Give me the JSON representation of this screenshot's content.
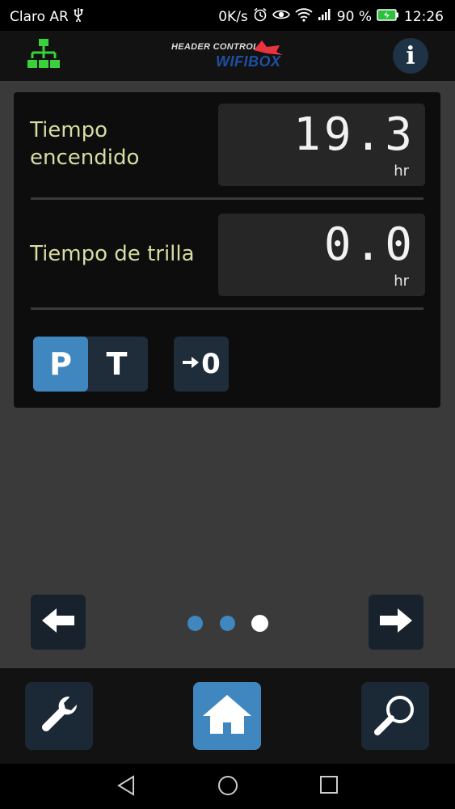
{
  "status_bar": {
    "carrier": "Claro AR",
    "speed": "0K/s",
    "battery_percent": "90 %",
    "time": "12:26",
    "icons": [
      "usb-icon",
      "alarm-icon",
      "eye-icon",
      "wifi-icon",
      "signal-icon",
      "battery-charging-icon"
    ]
  },
  "header": {
    "logo_top": "HEADER CONTROL",
    "logo_main": "WIFIBOX",
    "info_label": "i",
    "icons": [
      "network-tree-icon",
      "info-icon"
    ]
  },
  "panel": {
    "rows": [
      {
        "label_line1": "Tiempo",
        "label_line2": "encendido",
        "value": "19.3",
        "unit": "hr"
      },
      {
        "label": "Tiempo de trilla",
        "value": "0.0",
        "unit": "hr"
      }
    ],
    "toggle": {
      "options": [
        "P",
        "T"
      ],
      "selected": "P"
    },
    "reset_label": "0",
    "reset_icon": "arrow-right-icon"
  },
  "pager": {
    "page_count": 3,
    "current_page": 3,
    "dot_inactive_color": "#3f87be",
    "dot_active_color": "#ffffff",
    "icons": [
      "arrow-left-icon",
      "arrow-right-icon"
    ]
  },
  "toolbar": {
    "items": [
      {
        "name": "settings",
        "icon": "wrench-icon",
        "active": false
      },
      {
        "name": "home",
        "icon": "home-icon",
        "active": true
      },
      {
        "name": "search",
        "icon": "magnifier-icon",
        "active": false
      }
    ],
    "accent_color": "#3f87be"
  },
  "system_nav": {
    "icons": [
      "back-icon",
      "home-circle-icon",
      "recents-icon"
    ]
  }
}
